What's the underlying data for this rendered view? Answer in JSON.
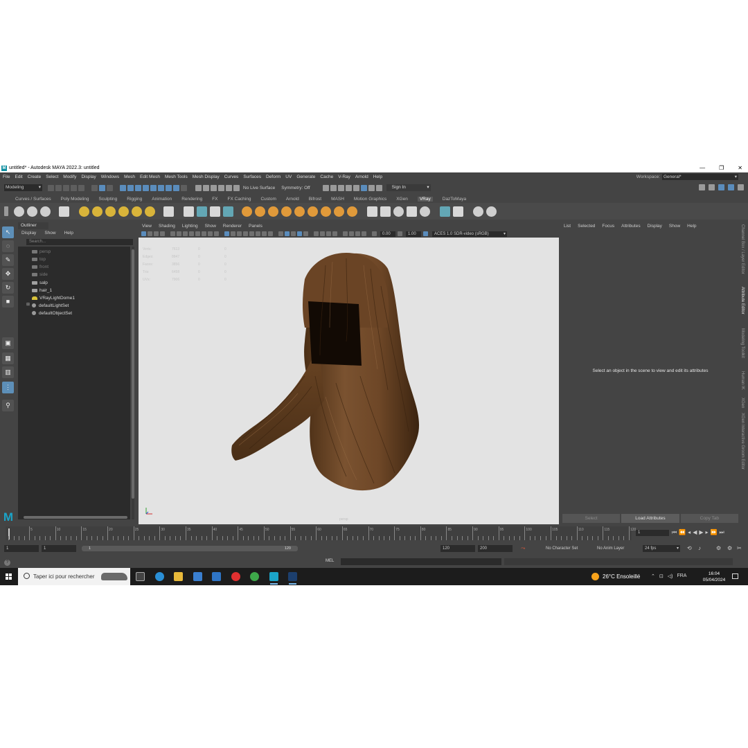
{
  "window": {
    "title": "untitled* - Autodesk MAYA 2022.3: untitled",
    "logo": "M"
  },
  "menubar": [
    "File",
    "Edit",
    "Create",
    "Select",
    "Modify",
    "Display",
    "Windows",
    "Mesh",
    "Edit Mesh",
    "Mesh Tools",
    "Mesh Display",
    "Curves",
    "Surfaces",
    "Deform",
    "UV",
    "Generate",
    "Cache",
    "V-Ray",
    "Arnold",
    "Help"
  ],
  "workspace": {
    "label": "Workspace:",
    "value": "General*"
  },
  "statusline": {
    "mode": "Modeling",
    "live_surface": "No Live Surface",
    "symmetry": "Symmetry: Off",
    "sign_in": "Sign In"
  },
  "shelf_tabs": [
    "Curves / Surfaces",
    "Poly Modeling",
    "Sculpting",
    "Rigging",
    "Animation",
    "Rendering",
    "FX",
    "FX Caching",
    "Custom",
    "Arnold",
    "Bifrost",
    "MASH",
    "Motion Graphics",
    "XGen",
    "VRay",
    "DazToMaya"
  ],
  "shelf_active": "VRay",
  "outliner": {
    "title": "Outliner",
    "menu": [
      "Display",
      "Show",
      "Help"
    ],
    "search_placeholder": "Search...",
    "items": [
      {
        "name": "persp",
        "dim": true
      },
      {
        "name": "top",
        "dim": true
      },
      {
        "name": "front",
        "dim": true
      },
      {
        "name": "side",
        "dim": true
      },
      {
        "name": "salp",
        "dim": false
      },
      {
        "name": "hair_1",
        "dim": false
      },
      {
        "name": "VRayLightDome1",
        "dim": false
      },
      {
        "name": "defaultLightSet",
        "dim": false
      },
      {
        "name": "defaultObjectSet",
        "dim": false
      }
    ]
  },
  "viewport": {
    "menu": [
      "View",
      "Shading",
      "Lighting",
      "Show",
      "Renderer",
      "Panels"
    ],
    "exposure": "0.00",
    "gamma": "1.00",
    "color_management": "ACES 1.0 SDR-video (sRGB)",
    "camera": "persp",
    "hud": [
      {
        "label": "Verts:",
        "v1": "7613",
        "v2": "0",
        "v3": "0"
      },
      {
        "label": "Edges:",
        "v1": "8847",
        "v2": "0",
        "v3": "0"
      },
      {
        "label": "Faces:",
        "v1": "3856",
        "v2": "0",
        "v3": "0"
      },
      {
        "label": "Tris:",
        "v1": "6458",
        "v2": "0",
        "v3": "0"
      },
      {
        "label": "UVs:",
        "v1": "7906",
        "v2": "0",
        "v3": "0"
      }
    ]
  },
  "attribute_editor": {
    "menu": [
      "List",
      "Selected",
      "Focus",
      "Attributes",
      "Display",
      "Show",
      "Help"
    ],
    "message": "Select an object in the scene to view and edit its attributes",
    "buttons": [
      "Select",
      "Load Attributes",
      "Copy Tab"
    ]
  },
  "side_tabs": [
    "Channel Box / Layer Editor",
    "Attribute Editor",
    "Modeling Toolkit",
    "Human IK",
    "XGen",
    "XGen Interactive Groom Editor"
  ],
  "timeline": {
    "ticks": [
      "5",
      "10",
      "15",
      "20",
      "25",
      "30",
      "35",
      "40",
      "45",
      "50",
      "55",
      "60",
      "65",
      "70",
      "75",
      "80",
      "85",
      "90",
      "95",
      "100",
      "105",
      "110",
      "115",
      "120"
    ],
    "current_frame": "1"
  },
  "range": {
    "start": "1",
    "inner_start": "1",
    "slider_start": "1",
    "slider_end": "120",
    "end": "120",
    "anim_end": "200",
    "character_set": "No Character Set",
    "anim_layer": "No Anim Layer",
    "fps": "24 fps"
  },
  "cmdline": {
    "lang": "MEL"
  },
  "taskbar": {
    "search": "Taper ici pour rechercher",
    "weather": "26°C  Ensoleillé",
    "lang": "FRA",
    "time": "16:04",
    "date": "05/04/2024"
  },
  "colors": {
    "maya_teal": "#1ba4c8",
    "selection_blue": "#5a8cbc",
    "hair_brown": "#6b4524"
  }
}
